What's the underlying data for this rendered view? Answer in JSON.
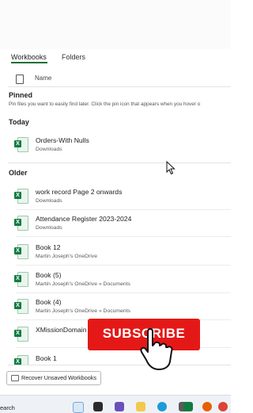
{
  "tabs": [
    {
      "label": "Workbooks",
      "active": true
    },
    {
      "label": "Folders",
      "active": false
    }
  ],
  "list_header": {
    "name_label": "Name",
    "icon": "document-icon"
  },
  "pinned": {
    "title": "Pinned",
    "hint": "Pin files you want to easily find later. Click the pin icon that appears when you hover o"
  },
  "today": {
    "title": "Today",
    "files": [
      {
        "name": "Orders-With Nulls",
        "location": "Downloads"
      }
    ]
  },
  "older": {
    "title": "Older",
    "files": [
      {
        "name": "work record Page 2 onwards",
        "location": "Downloads"
      },
      {
        "name": "Attendance Register 2023-2024",
        "location": "Downloads"
      },
      {
        "name": "Book 12",
        "location": "Martin Joseph's OneDrive"
      },
      {
        "name": "Book (5)",
        "location": "Martin Joseph's OneDrive » Documents"
      },
      {
        "name": "Book (4)",
        "location": "Martin Joseph's OneDrive » Documents"
      },
      {
        "name": "XMissionDomain",
        "location": ""
      },
      {
        "name": "Book 1",
        "location": ""
      }
    ]
  },
  "recover_button": {
    "label": "Recover Unsaved Workbooks"
  },
  "overlay": {
    "subscribe_text": "SUBSCRIBE"
  },
  "taskbar": {
    "search_label": "earch",
    "app_icons": [
      "copilot-icon",
      "task-view-icon",
      "widgets-icon",
      "file-explorer-icon",
      "edge-icon",
      "store-icon",
      "excel-icon",
      "firefox-icon",
      "chrome-icon"
    ]
  },
  "colors": {
    "excel_green": "#107c41",
    "accent": "#1e6f3a",
    "subscribe_red": "#e51818"
  }
}
